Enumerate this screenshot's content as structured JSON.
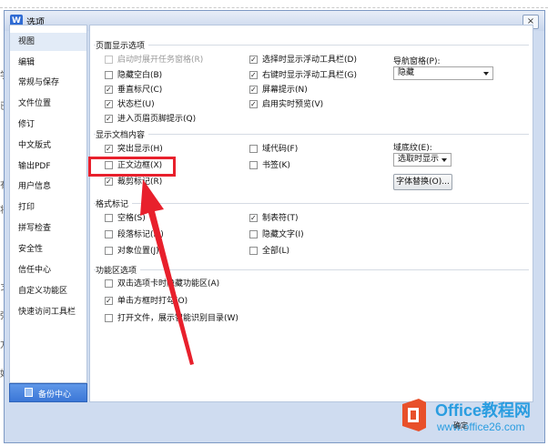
{
  "background": {
    "chars": [
      "学",
      "已",
      "有",
      "将",
      "习",
      "弹",
      "方",
      "好"
    ]
  },
  "window": {
    "app_icon": "W",
    "title": "选项",
    "close_glyph": "×"
  },
  "sidebar": {
    "items": [
      {
        "label": "视图",
        "active": true
      },
      {
        "label": "编辑"
      },
      {
        "label": "常规与保存"
      },
      {
        "label": "文件位置"
      },
      {
        "label": "修订"
      },
      {
        "label": "中文版式"
      },
      {
        "label": "输出PDF"
      },
      {
        "label": "用户信息"
      },
      {
        "label": "打印"
      },
      {
        "label": "拼写检查"
      },
      {
        "label": "安全性"
      },
      {
        "label": "信任中心"
      },
      {
        "label": "自定义功能区"
      },
      {
        "label": "快速访问工具栏"
      }
    ],
    "backup_label": "备份中心"
  },
  "page_display": {
    "title": "页面显示选项",
    "col1": [
      {
        "label": "启动时展开任务窗格(R)",
        "checked": false,
        "disabled": true
      },
      {
        "label": "隐藏空白(B)",
        "checked": false
      },
      {
        "label": "垂直标尺(C)",
        "checked": true
      },
      {
        "label": "状态栏(U)",
        "checked": true
      },
      {
        "label": "进入页眉页脚提示(Q)",
        "checked": true
      }
    ],
    "col2": [
      {
        "label": "选择时显示浮动工具栏(D)",
        "checked": true
      },
      {
        "label": "右键时显示浮动工具栏(G)",
        "checked": true
      },
      {
        "label": "屏幕提示(N)",
        "checked": true
      },
      {
        "label": "启用实时预览(V)",
        "checked": true
      }
    ],
    "nav_pane_label": "导航窗格(P):",
    "nav_pane_value": "隐藏"
  },
  "doc_content": {
    "title": "显示文档内容",
    "col1": [
      {
        "label": "突出显示(H)",
        "checked": true
      },
      {
        "label": "正文边框(X)",
        "checked": false
      },
      {
        "label": "裁剪标记(R)",
        "checked": true
      }
    ],
    "col2": [
      {
        "label": "域代码(F)",
        "checked": false
      },
      {
        "label": "书签(K)",
        "checked": false
      }
    ],
    "field_shading_label": "域底纹(E):",
    "field_shading_value": "选取时显示",
    "font_replace_label": "字体替换(O)..."
  },
  "format_marks": {
    "title": "格式标记",
    "col1": [
      {
        "label": "空格(S)",
        "checked": false
      },
      {
        "label": "段落标记(M)",
        "checked": false
      },
      {
        "label": "对象位置(J)",
        "checked": false
      }
    ],
    "col2": [
      {
        "label": "制表符(T)",
        "checked": true
      },
      {
        "label": "隐藏文字(I)",
        "checked": false
      },
      {
        "label": "全部(L)",
        "checked": false
      }
    ]
  },
  "ribbon": {
    "title": "功能区选项",
    "items": [
      {
        "label": "双击选项卡时隐藏功能区(A)",
        "checked": false
      },
      {
        "label": "单击方框时打勾(O)",
        "checked": true
      },
      {
        "label": "打开文件，展示智能识别目录(W)",
        "checked": false
      }
    ]
  },
  "watermark": {
    "title": "Office教程网",
    "url": "www.office26.com"
  },
  "ok_fragment": "确定",
  "colors": {
    "highlight": "#e8202c",
    "accent": "#3b77d7",
    "watermark": "#2a9de0"
  }
}
